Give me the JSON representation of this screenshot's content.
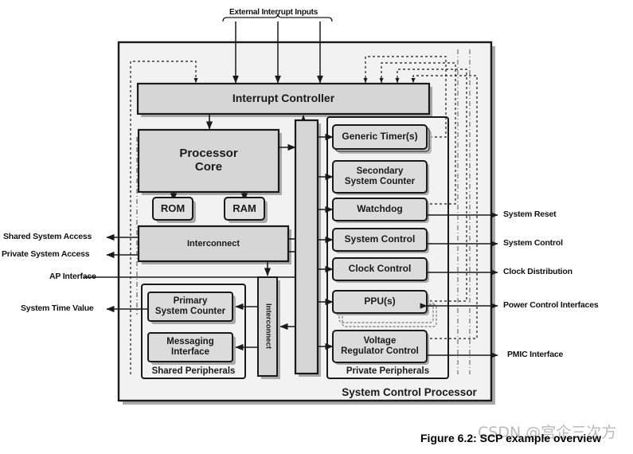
{
  "figure": {
    "caption": "Figure 6.2: SCP example overview",
    "watermark": "CSDN @宫企三次方"
  },
  "top": {
    "external_inputs_label": "External Interrupt Inputs"
  },
  "outer": {
    "system_label": "System Control Processor"
  },
  "blocks": {
    "interrupt_controller": "Interrupt Controller",
    "processor_core_line1": "Processor",
    "processor_core_line2": "Core",
    "rom": "ROM",
    "ram": "RAM",
    "interconnect_main": "Interconnect",
    "interconnect_vertical": "Interconnect",
    "primary_system_counter_line1": "Primary",
    "primary_system_counter_line2": "System Counter",
    "messaging_interface_line1": "Messaging",
    "messaging_interface_line2": "Interface",
    "shared_peripherals": "Shared Peripherals",
    "generic_timers": "Generic Timer(s)",
    "secondary_system_counter_line1": "Secondary",
    "secondary_system_counter_line2": "System Counter",
    "watchdog": "Watchdog",
    "system_control": "System Control",
    "clock_control": "Clock Control",
    "ppus": "PPU(s)",
    "voltage_regulator_control_line1": "Voltage",
    "voltage_regulator_control_line2": "Regulator Control",
    "private_peripherals": "Private Peripherals"
  },
  "left_labels": [
    {
      "text": "Shared System Access"
    },
    {
      "text": "Private System Access"
    },
    {
      "text": "AP Interface"
    },
    {
      "text": "System Time Value"
    }
  ],
  "right_labels": [
    {
      "text": "System Reset"
    },
    {
      "text": "System Control"
    },
    {
      "text": "Clock Distribution"
    },
    {
      "text": "Power Control Interfaces"
    },
    {
      "text": "PMIC Interface"
    }
  ],
  "colors": {
    "block_fill": "#dcdcdc",
    "block_stroke": "#1a1a1a",
    "outer_fill": "#f2f2f2",
    "shadow": "#a8a8a8",
    "line": "#1a1a1a",
    "text": "#111111"
  }
}
